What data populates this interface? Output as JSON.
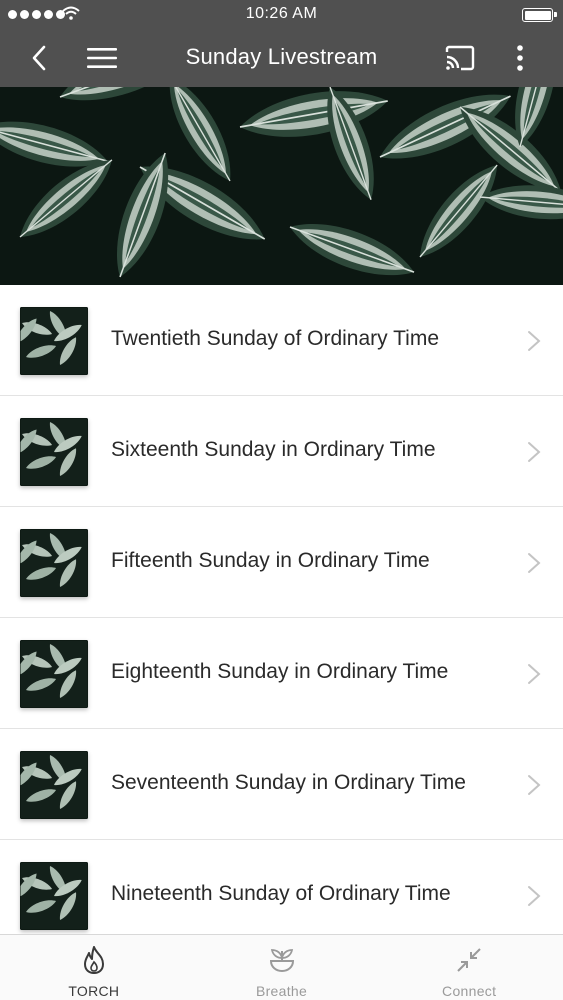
{
  "status_bar": {
    "time": "10:26 AM"
  },
  "header": {
    "title": "Sunday Livestream"
  },
  "colors": {
    "header_bg": "#505050",
    "text": "#2a2a2a",
    "tab_active": "#3a3a3a",
    "tab_inactive": "#9a9a9a"
  },
  "items": [
    {
      "label": "Twentieth Sunday of Ordinary Time"
    },
    {
      "label": "Sixteenth Sunday in Ordinary Time"
    },
    {
      "label": "Fifteenth Sunday in Ordinary Time"
    },
    {
      "label": "Eighteenth Sunday in Ordinary Time"
    },
    {
      "label": "Seventeenth Sunday in Ordinary Time"
    },
    {
      "label": "Nineteenth Sunday of Ordinary Time"
    }
  ],
  "tabs": [
    {
      "label": "TORCH",
      "icon": "flame-icon",
      "active": true
    },
    {
      "label": "Breathe",
      "icon": "plant-bowl-icon",
      "active": false
    },
    {
      "label": "Connect",
      "icon": "arrows-in-icon",
      "active": false
    }
  ]
}
